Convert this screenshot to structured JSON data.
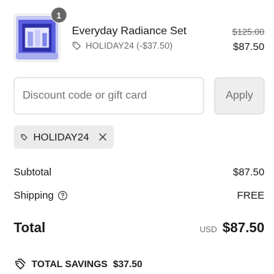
{
  "cart": {
    "item": {
      "quantity": "1",
      "title": "Everyday Radiance Set",
      "discount_label": "HOLIDAY24 (-$37.50)",
      "compare_price": "$125.00",
      "price": "$87.50",
      "thumbnail_icon": "product-box-image"
    }
  },
  "discount": {
    "placeholder": "Discount code or gift card",
    "value": "",
    "apply_label": "Apply",
    "applied_code": "HOLIDAY24"
  },
  "summary": {
    "subtotal_label": "Subtotal",
    "subtotal_value": "$87.50",
    "shipping_label": "Shipping",
    "shipping_value": "FREE",
    "total_label": "Total",
    "currency": "USD",
    "total_value": "$87.50",
    "savings_label": "TOTAL SAVINGS",
    "savings_value": "$37.50"
  },
  "colors": {
    "badge": "#666666",
    "tag_bg": "#ebebeb",
    "apply_bg": "#eeeeee",
    "product_blue": "#3a3fd8"
  }
}
